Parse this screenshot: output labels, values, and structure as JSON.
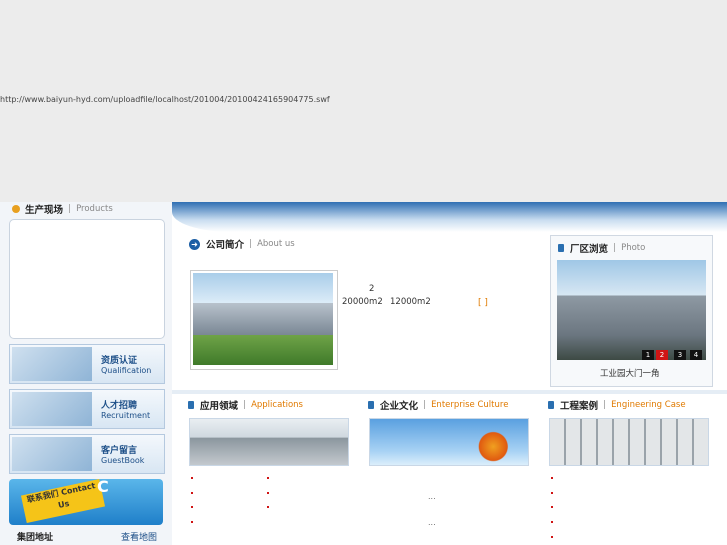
{
  "banner": {
    "flash_url": "http://www.baiyun-hyd.com/uploadfile/localhost/201004/20100424165904775.swf"
  },
  "products": {
    "title_cn": "生产现场",
    "title_en": "Products"
  },
  "side_buttons": [
    {
      "cn": "资质认证",
      "en": "Qualification"
    },
    {
      "cn": "人才招聘",
      "en": "Recruitment"
    },
    {
      "cn": "客户留言",
      "en": "GuestBook"
    }
  ],
  "contact": {
    "sign_text": "联系我们 Contact Us",
    "letter": "C",
    "address_label": "集团地址",
    "map_link": "查看地图"
  },
  "about": {
    "title_cn": "公司简介",
    "title_en": "About us",
    "line1": "2",
    "area1": "20000m2",
    "area2": "12000m2",
    "more": "[ ]"
  },
  "photo": {
    "title_cn": "厂区浏览",
    "title_en": "Photo",
    "caption": "工业园大门一角",
    "pages": [
      "1",
      "2",
      "3",
      "4"
    ],
    "active_page": 2
  },
  "applications": {
    "title_cn": "应用领域",
    "title_en": "Applications"
  },
  "culture": {
    "title_cn": "企业文化",
    "title_en": "Enterprise Culture",
    "ellipsis1": "...",
    "ellipsis2": "..."
  },
  "cases": {
    "title_cn": "工程案例",
    "title_en": "Engineering Case"
  },
  "colors": {
    "accent_blue": "#1d5fa5",
    "accent_orange": "#e07a00",
    "bullet_red": "#d01414"
  }
}
